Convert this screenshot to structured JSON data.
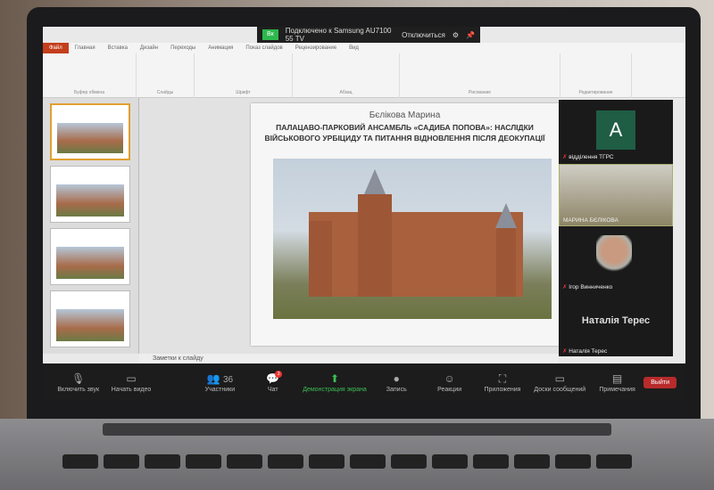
{
  "share_bar": {
    "status_tag": "Вк",
    "connected": "Подключено к Samsung AU7100 55 TV",
    "disconnect": "Отключиться"
  },
  "ribbon": {
    "tabs": [
      "Файл",
      "Главная",
      "Вставка",
      "Дизайн",
      "Переходы",
      "Анимация",
      "Показ слайдов",
      "Рецензирование",
      "Вид"
    ],
    "groups": [
      "Буфер обмена",
      "Слайды",
      "Шрифт",
      "Абзац",
      "Рисование",
      "Редактирование"
    ]
  },
  "slide": {
    "author": "Бєлікова Марина",
    "title": "ПАЛАЦАВО-ПАРКОВИЙ АНСАМБЛЬ «САДИБА ПОПОВА»: НАСЛІДКИ ВІЙСЬКОВОГО УРБІЦИДУ ТА ПИТАННЯ ВІДНОВЛЕННЯ ПІСЛЯ ДЕОКУПАЦІЇ"
  },
  "notes_placeholder": "Заметки к слайду",
  "participants": [
    {
      "initial": "A",
      "name": "відділення ТГРС"
    },
    {
      "name": "МАРИНА БЄЛІКОВА"
    },
    {
      "name": "Ігор Винниченко"
    },
    {
      "display": "Наталія Терес",
      "name": "Наталія Терес"
    }
  ],
  "toolbar": {
    "unmute": "Включить звук",
    "video": "Начать видео",
    "participants": "Участники",
    "participants_count": "36",
    "chat": "Чат",
    "chat_badge": "3",
    "share": "Демонстрация экрана",
    "record": "Запись",
    "reactions": "Реакции",
    "apps": "Приложения",
    "whiteboards": "Доски сообщений",
    "notes": "Примечания",
    "leave": "Выйти"
  }
}
